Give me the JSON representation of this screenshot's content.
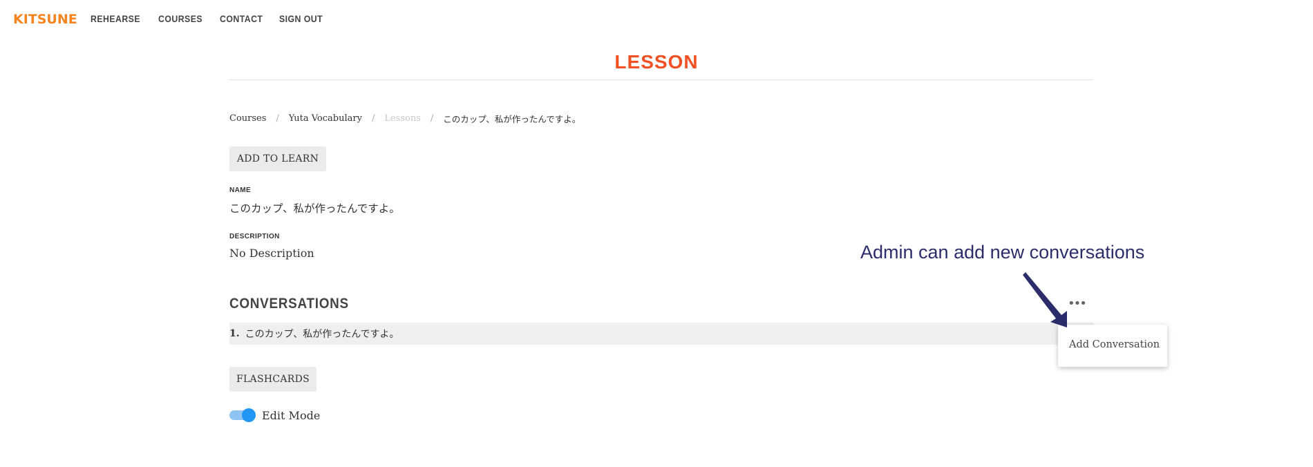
{
  "nav": {
    "logo": "KITSUNE",
    "links": [
      "REHEARSE",
      "COURSES",
      "CONTACT",
      "SIGN OUT"
    ]
  },
  "page": {
    "title": "LESSON"
  },
  "breadcrumb": {
    "items": [
      "Courses",
      "Yuta Vocabulary",
      "Lessons",
      "このカップ、私が作ったんですよ。"
    ],
    "separator": "/"
  },
  "buttons": {
    "add_to_learn": "ADD TO LEARN",
    "flashcards": "FLASHCARDS"
  },
  "fields": {
    "name_label": "NAME",
    "name_value": "このカップ、私が作ったんですよ。",
    "description_label": "DESCRIPTION",
    "description_value": "No Description"
  },
  "conversations": {
    "title": "CONVERSATIONS",
    "more_icon": "•••",
    "items": [
      {
        "number": "1.",
        "text": "このカップ、私が作ったんですよ。"
      }
    ]
  },
  "menu": {
    "items": [
      "Add Conversation"
    ]
  },
  "edit_mode": {
    "label": "Edit Mode",
    "enabled": true
  },
  "annotation": {
    "text": "Admin can add new conversations",
    "color": "#2b2d6b"
  },
  "colors": {
    "logo": "#f5841f",
    "title": "#f05022",
    "toggle": "#2196f3"
  }
}
